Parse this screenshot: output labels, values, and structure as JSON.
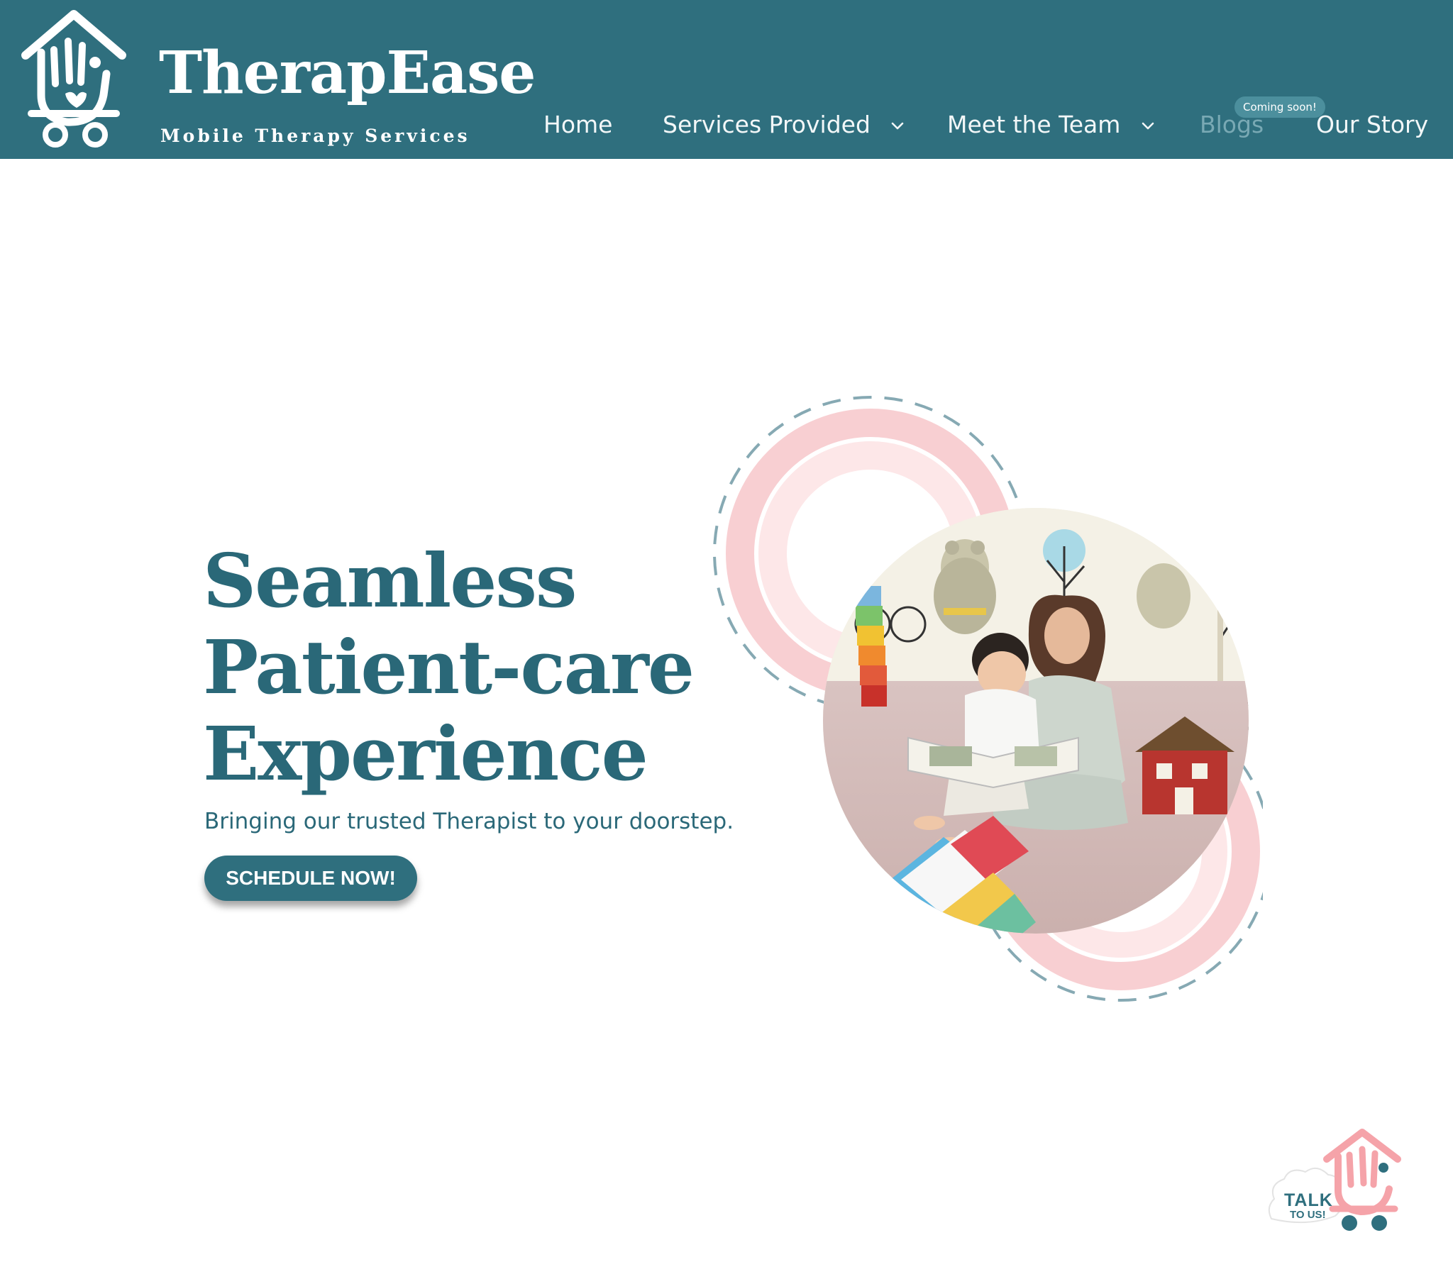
{
  "brand": {
    "name": "TherapEase",
    "tagline": "Mobile Therapy Services"
  },
  "nav": {
    "home": "Home",
    "services": "Services Provided",
    "team": "Meet the Team",
    "blogs": "Blogs",
    "blogs_badge": "Coming soon!",
    "story": "Our Story"
  },
  "hero": {
    "title_line1": "Seamless",
    "title_line2": "Patient-care",
    "title_line3": "Experience",
    "subtitle": "Bringing our trusted Therapist to your doorstep.",
    "cta_label": "SCHEDULE NOW!"
  },
  "chat_widget": {
    "line1": "TALK",
    "line2": "TO US!"
  },
  "colors": {
    "header_bg": "#2f6f7e",
    "brand_teal": "#2a6878",
    "accent_pink": "#f7c9cc",
    "nav_disabled": "#79a9b4"
  },
  "icons": {
    "logo": "house-hand-cart-icon",
    "dropdown": "chevron-down-icon",
    "chat": "talk-to-us-icon"
  }
}
